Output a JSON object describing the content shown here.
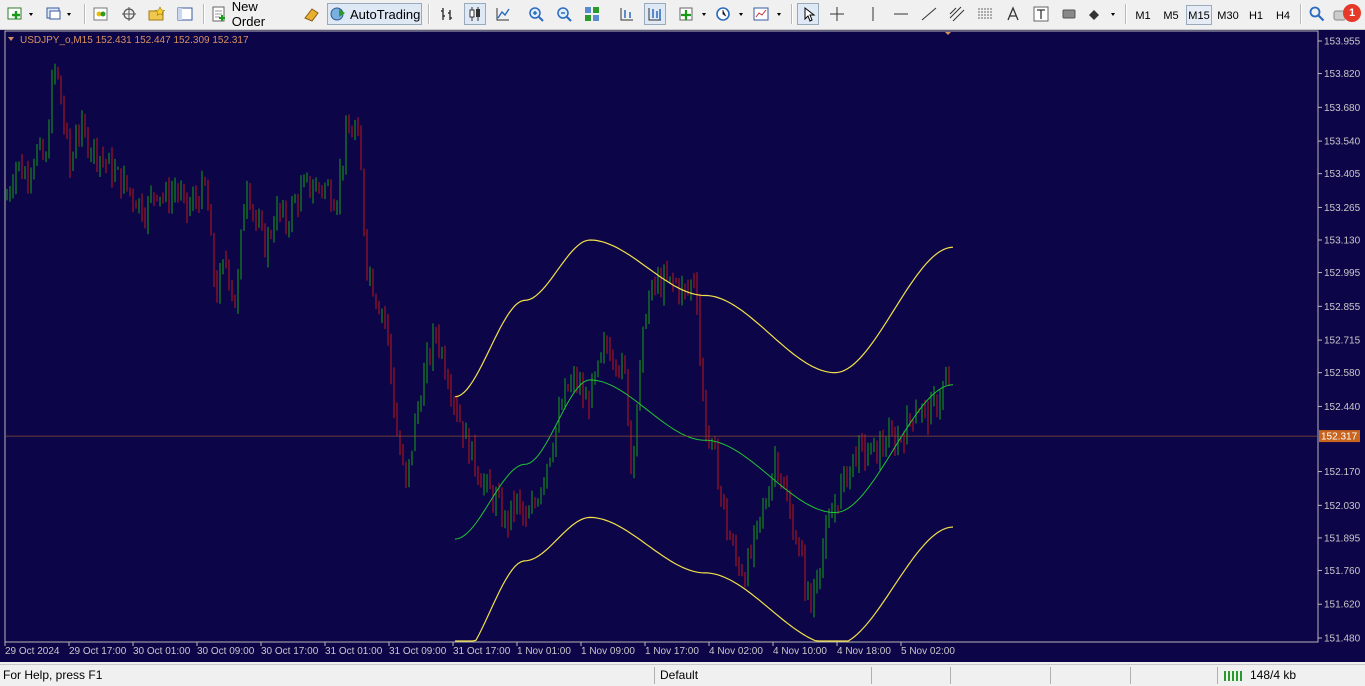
{
  "toolbar": {
    "new_order_label": "New Order",
    "autotrading_label": "AutoTrading",
    "timeframes": [
      "M1",
      "M5",
      "M15",
      "M30",
      "H1",
      "H4"
    ],
    "active_timeframe": "M15",
    "notification_count": "1"
  },
  "chart": {
    "header": "USDJPY_o,M15  152.431 152.447 152.309 152.317",
    "current_price": "152.317",
    "price_labels": [
      "153.955",
      "153.820",
      "153.680",
      "153.540",
      "153.405",
      "153.265",
      "153.130",
      "152.995",
      "152.855",
      "152.715",
      "152.580",
      "152.440",
      "152.170",
      "152.030",
      "151.895",
      "151.760",
      "151.620",
      "151.480"
    ],
    "time_labels": [
      "29 Oct 2024",
      "29 Oct 17:00",
      "30 Oct 01:00",
      "30 Oct 09:00",
      "30 Oct 17:00",
      "31 Oct 01:00",
      "31 Oct 09:00",
      "31 Oct 17:00",
      "1 Nov 01:00",
      "1 Nov 09:00",
      "1 Nov 17:00",
      "4 Nov 02:00",
      "4 Nov 10:00",
      "4 Nov 18:00",
      "5 Nov 02:00"
    ],
    "colors": {
      "background": "#0c0548",
      "up": "#16a016",
      "down": "#c01818",
      "channel_outer": "#f2e04a",
      "channel_mid": "#22c435",
      "grid_text": "#c8c8c8",
      "current_price_bg": "#c8641e"
    }
  },
  "chart_data": {
    "type": "candlestick",
    "symbol": "USDJPY_o",
    "timeframe": "M15",
    "last_bar": {
      "open": 152.431,
      "high": 152.447,
      "low": 152.309,
      "close": 152.317
    },
    "ylim": [
      151.48,
      153.955
    ],
    "y_ticks": [
      153.955,
      153.82,
      153.68,
      153.54,
      153.405,
      153.265,
      153.13,
      152.995,
      152.855,
      152.715,
      152.58,
      152.44,
      152.17,
      152.03,
      151.895,
      151.76,
      151.62,
      151.48
    ],
    "x_ticks": [
      "29 Oct 2024",
      "29 Oct 17:00",
      "30 Oct 01:00",
      "30 Oct 09:00",
      "30 Oct 17:00",
      "31 Oct 01:00",
      "31 Oct 09:00",
      "31 Oct 17:00",
      "1 Nov 01:00",
      "1 Nov 09:00",
      "1 Nov 17:00",
      "4 Nov 02:00",
      "4 Nov 10:00",
      "4 Nov 18:00",
      "5 Nov 02:00"
    ],
    "close_path": [
      [
        0,
        153.3
      ],
      [
        10,
        153.45
      ],
      [
        20,
        153.4
      ],
      [
        30,
        153.5
      ],
      [
        40,
        153.45
      ],
      [
        45,
        153.75
      ],
      [
        50,
        153.85
      ],
      [
        55,
        153.7
      ],
      [
        60,
        153.55
      ],
      [
        65,
        153.4
      ],
      [
        70,
        153.6
      ],
      [
        80,
        153.55
      ],
      [
        90,
        153.5
      ],
      [
        100,
        153.45
      ],
      [
        110,
        153.4
      ],
      [
        120,
        153.35
      ],
      [
        130,
        153.3
      ],
      [
        140,
        153.25
      ],
      [
        150,
        153.35
      ],
      [
        160,
        153.3
      ],
      [
        170,
        153.35
      ],
      [
        180,
        153.25
      ],
      [
        190,
        153.3
      ],
      [
        200,
        153.35
      ],
      [
        205,
        153.1
      ],
      [
        210,
        152.9
      ],
      [
        220,
        153.05
      ],
      [
        230,
        152.85
      ],
      [
        240,
        153.4
      ],
      [
        250,
        153.2
      ],
      [
        260,
        153.1
      ],
      [
        270,
        153.25
      ],
      [
        280,
        153.2
      ],
      [
        290,
        153.3
      ],
      [
        300,
        153.35
      ],
      [
        310,
        153.35
      ],
      [
        320,
        153.35
      ],
      [
        330,
        153.3
      ],
      [
        340,
        153.55
      ],
      [
        350,
        153.6
      ],
      [
        355,
        153.4
      ],
      [
        360,
        153.05
      ],
      [
        370,
        152.9
      ],
      [
        380,
        152.8
      ],
      [
        390,
        152.35
      ],
      [
        400,
        152.1
      ],
      [
        410,
        152.4
      ],
      [
        420,
        152.6
      ],
      [
        430,
        152.75
      ],
      [
        440,
        152.6
      ],
      [
        450,
        152.45
      ],
      [
        460,
        152.3
      ],
      [
        470,
        152.2
      ],
      [
        480,
        152.1
      ],
      [
        490,
        152.05
      ],
      [
        500,
        151.95
      ],
      [
        510,
        152.05
      ],
      [
        520,
        151.95
      ],
      [
        530,
        152.05
      ],
      [
        540,
        152.2
      ],
      [
        550,
        152.35
      ],
      [
        560,
        152.5
      ],
      [
        570,
        152.55
      ],
      [
        580,
        152.45
      ],
      [
        590,
        152.55
      ],
      [
        600,
        152.7
      ],
      [
        610,
        152.65
      ],
      [
        620,
        152.55
      ],
      [
        625,
        152.2
      ],
      [
        630,
        152.4
      ],
      [
        640,
        152.85
      ],
      [
        650,
        152.95
      ],
      [
        660,
        152.95
      ],
      [
        670,
        152.95
      ],
      [
        680,
        152.9
      ],
      [
        690,
        153.0
      ],
      [
        695,
        152.55
      ],
      [
        700,
        152.35
      ],
      [
        710,
        152.2
      ],
      [
        720,
        151.95
      ],
      [
        730,
        151.8
      ],
      [
        740,
        151.75
      ],
      [
        750,
        151.9
      ],
      [
        760,
        152.05
      ],
      [
        770,
        152.25
      ],
      [
        780,
        152.05
      ],
      [
        790,
        151.9
      ],
      [
        800,
        151.7
      ],
      [
        805,
        151.6
      ],
      [
        810,
        151.75
      ],
      [
        820,
        151.9
      ],
      [
        830,
        152.05
      ],
      [
        840,
        152.15
      ],
      [
        850,
        152.25
      ],
      [
        860,
        152.25
      ],
      [
        870,
        152.25
      ],
      [
        880,
        152.3
      ],
      [
        890,
        152.3
      ],
      [
        900,
        152.35
      ],
      [
        910,
        152.45
      ],
      [
        920,
        152.4
      ],
      [
        930,
        152.45
      ],
      [
        940,
        152.55
      ],
      [
        945,
        152.47
      ],
      [
        948,
        152.32
      ]
    ],
    "regression_channel": {
      "x_start": 450,
      "x_end": 948,
      "mid": [
        [
          450,
          151.89
        ],
        [
          520,
          152.2
        ],
        [
          585,
          152.55
        ],
        [
          700,
          152.3
        ],
        [
          830,
          152.0
        ],
        [
          948,
          152.53
        ]
      ],
      "upper": [
        [
          450,
          152.48
        ],
        [
          520,
          152.88
        ],
        [
          585,
          153.13
        ],
        [
          700,
          152.9
        ],
        [
          830,
          152.58
        ],
        [
          948,
          153.1
        ]
      ],
      "lower": [
        [
          450,
          151.38
        ],
        [
          520,
          151.8
        ],
        [
          585,
          151.98
        ],
        [
          700,
          151.75
        ],
        [
          830,
          151.45
        ],
        [
          948,
          151.94
        ]
      ]
    }
  },
  "statusbar": {
    "help": "For Help, press F1",
    "profile": "Default",
    "traffic": "148/4 kb"
  }
}
